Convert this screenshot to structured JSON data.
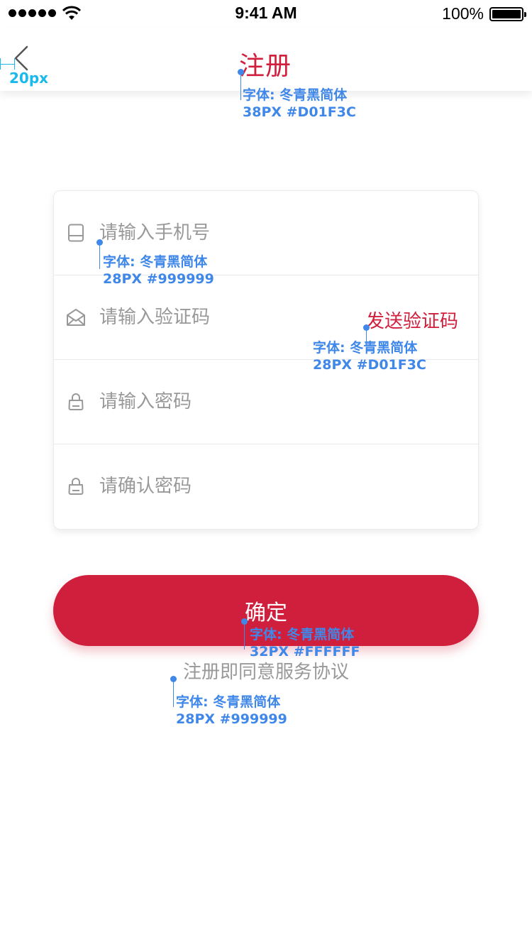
{
  "status_bar": {
    "time": "9:41 AM",
    "battery": "100%"
  },
  "nav": {
    "title": "注册",
    "back_icon": "chevron-left-icon"
  },
  "form": {
    "phone": {
      "placeholder": "请输入手机号",
      "icon": "phone-icon"
    },
    "code": {
      "placeholder": "请输入验证码",
      "icon": "envelope-icon",
      "send_label": "发送验证码"
    },
    "password": {
      "placeholder": "请输入密码",
      "icon": "lock-icon"
    },
    "confirm_password": {
      "placeholder": "请确认密码",
      "icon": "lock-icon"
    }
  },
  "submit": {
    "label": "确定"
  },
  "agreement": {
    "text": "注册即同意服务协议"
  },
  "annotations": {
    "back_margin": "20px",
    "title": {
      "font": "字体: 冬青黑简体",
      "spec": "38PX #D01F3C"
    },
    "phone": {
      "font": "字体: 冬青黑简体",
      "spec": "28PX #999999"
    },
    "send_code": {
      "font": "字体: 冬青黑简体",
      "spec": "28PX #D01F3C"
    },
    "submit": {
      "font": "字体: 冬青黑简体",
      "spec": "32PX #FFFFFF"
    },
    "agreement": {
      "font": "字体: 冬青黑简体",
      "spec": "28PX #999999"
    }
  },
  "colors": {
    "brand": "#D01F3C",
    "placeholder": "#999999",
    "annotation": "#3F87E8",
    "measure": "#19B9EE"
  }
}
